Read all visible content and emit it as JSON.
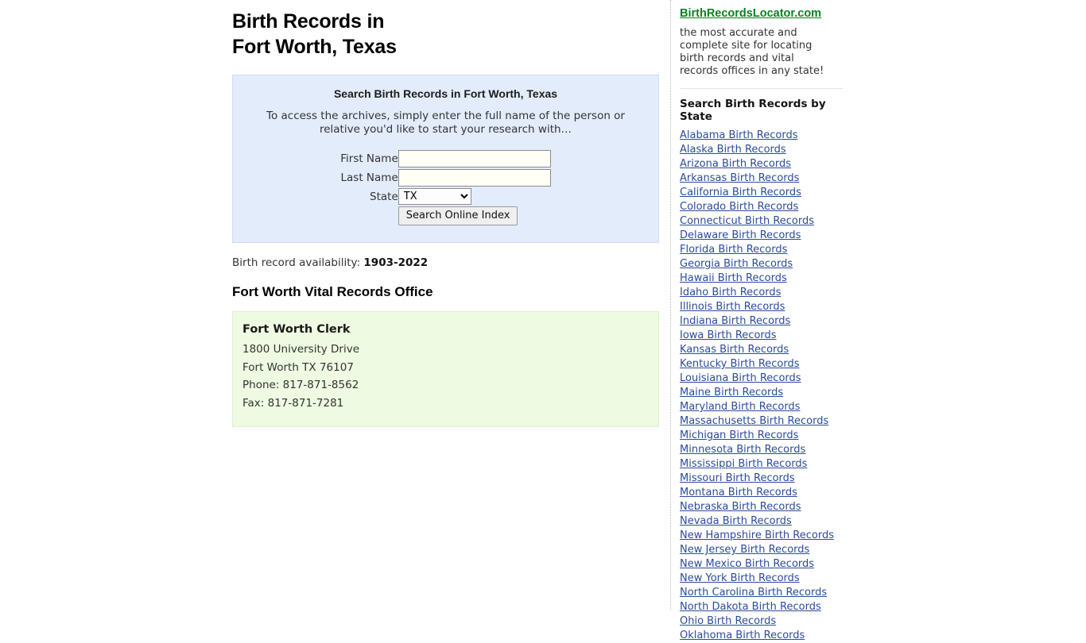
{
  "page": {
    "title_line1": "Birth Records in",
    "title_line2": "Fort Worth, Texas"
  },
  "search_panel": {
    "heading": "Search Birth Records in Fort Worth, Texas",
    "blurb": "To access the archives, simply enter the full name of the person or relative you'd like to start your research with…",
    "first_name_label": "First Name",
    "first_name_value": "",
    "first_name_placeholder": "",
    "last_name_label": "Last Name",
    "last_name_value": "",
    "last_name_placeholder": "",
    "state_label": "State",
    "state_selected": "TX",
    "state_options": [
      "TX"
    ],
    "submit_label": "Search Online Index",
    "background_color": "#e2ecfb"
  },
  "availability": {
    "label": "Birth record availability:",
    "value": "1903-2022"
  },
  "office_section": {
    "heading": "Fort Worth Vital Records Office",
    "card": {
      "name": "Fort Worth Clerk",
      "lines": [
        "1800 University Drive",
        "Fort Worth TX 76107",
        "Phone: 817-871-8562",
        "Fax: 817-871-7281"
      ],
      "background_color": "#eefae1"
    }
  },
  "sidebar": {
    "brand": "BirthRecordsLocator.com",
    "brand_color": "#0a8021",
    "blurb": "the most accurate and complete site for locating birth records and vital records offices in any state!",
    "heading": "Search Birth Records by State",
    "link_color": "#2b4b9b",
    "states": [
      "Alabama Birth Records",
      "Alaska Birth Records",
      "Arizona Birth Records",
      "Arkansas Birth Records",
      "California Birth Records",
      "Colorado Birth Records",
      "Connecticut Birth Records",
      "Delaware Birth Records",
      "Florida Birth Records",
      "Georgia Birth Records",
      "Hawaii Birth Records",
      "Idaho Birth Records",
      "Illinois Birth Records",
      "Indiana Birth Records",
      "Iowa Birth Records",
      "Kansas Birth Records",
      "Kentucky Birth Records",
      "Louisiana Birth Records",
      "Maine Birth Records",
      "Maryland Birth Records",
      "Massachusetts Birth Records",
      "Michigan Birth Records",
      "Minnesota Birth Records",
      "Mississippi Birth Records",
      "Missouri Birth Records",
      "Montana Birth Records",
      "Nebraska Birth Records",
      "Nevada Birth Records",
      "New Hampshire Birth Records",
      "New Jersey Birth Records",
      "New Mexico Birth Records",
      "New York Birth Records",
      "North Carolina Birth Records",
      "North Dakota Birth Records",
      "Ohio Birth Records",
      "Oklahoma Birth Records"
    ]
  }
}
